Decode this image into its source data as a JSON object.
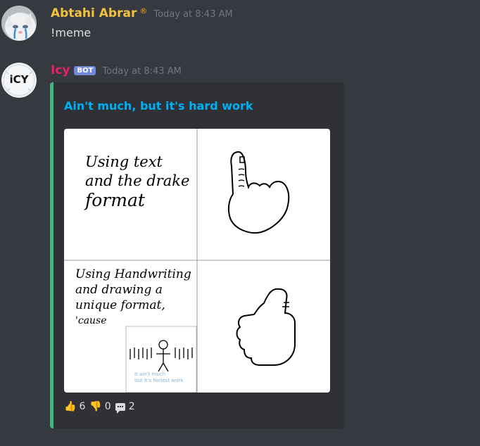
{
  "messages": [
    {
      "username": "Abtahi Abrar",
      "username_color": "#f4c23f",
      "badge_icon": "®",
      "timestamp": "Today at 8:43 AM",
      "text": "!meme"
    },
    {
      "username": "Icy",
      "username_color": "#e91e63",
      "bot_tag": "BOT",
      "timestamp": "Today at 8:43 AM",
      "avatar_text": "iCY",
      "embed": {
        "title": "Ain't much, but it's hard work",
        "accent_color": "#43b581",
        "image": {
          "top_left_text": [
            "Using text",
            "and the drake",
            "format"
          ],
          "bottom_left_text": [
            "Using Handwriting",
            "and drawing a",
            "unique format,",
            "'cause"
          ],
          "inset_caption": [
            "It ain't much",
            "but it's honest work"
          ]
        }
      }
    }
  ],
  "reactions": [
    {
      "icon": "thumbs-up-icon",
      "emoji": "👍",
      "count": "6"
    },
    {
      "icon": "thumbs-down-icon",
      "emoji": "👎",
      "count": "0"
    },
    {
      "icon": "speech-balloon-icon",
      "count": "2"
    }
  ]
}
